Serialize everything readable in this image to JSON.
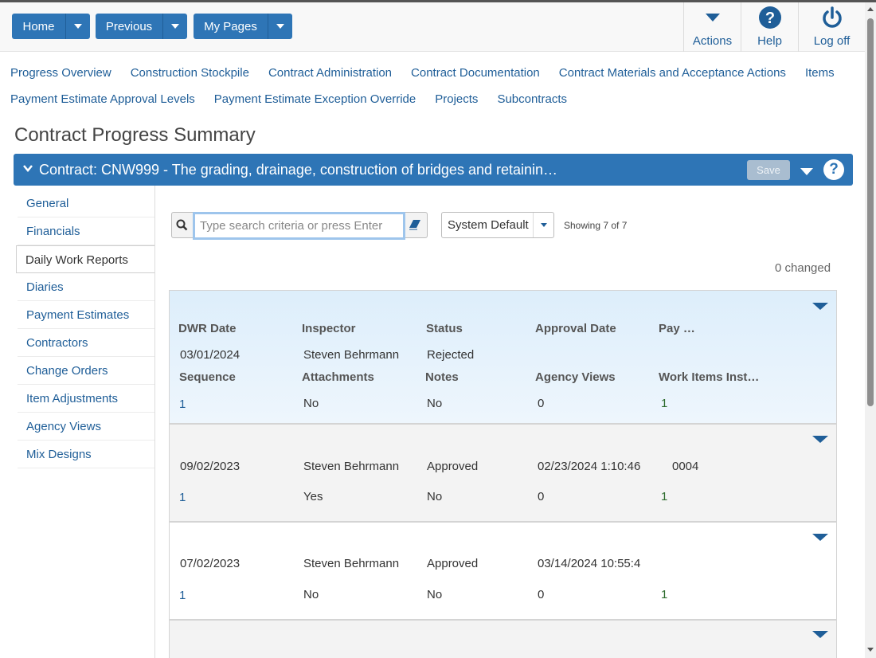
{
  "toolbar": {
    "home": "Home",
    "previous": "Previous",
    "my_pages": "My Pages",
    "actions": "Actions",
    "help": "Help",
    "logoff": "Log off"
  },
  "nav": {
    "row1": [
      "Progress Overview",
      "Construction Stockpile",
      "Contract Administration",
      "Contract Documentation",
      "Contract Materials and Acceptance Actions",
      "Items"
    ],
    "row2": [
      "Payment Estimate Approval Levels",
      "Payment Estimate Exception Override",
      "Projects",
      "Subcontracts"
    ]
  },
  "page_title": "Contract Progress Summary",
  "contract_bar": {
    "title": "Contract: CNW999 - The grading, drainage, construction of bridges and retainin…",
    "save": "Save",
    "help": "?"
  },
  "sidebar": [
    "General",
    "Financials",
    "Daily Work Reports",
    "Diaries",
    "Payment Estimates",
    "Contractors",
    "Change Orders",
    "Item Adjustments",
    "Agency Views",
    "Mix Designs"
  ],
  "search": {
    "placeholder": "Type search criteria or press Enter",
    "view": "System Default",
    "showing": "Showing 7 of 7",
    "changed": "0 changed"
  },
  "headers": {
    "dwr_date": "DWR Date",
    "inspector": "Inspector",
    "status": "Status",
    "approval_date": "Approval Date",
    "pay": "Pay …",
    "sequence": "Sequence",
    "attachments": "Attachments",
    "notes": "Notes",
    "agency_views": "Agency Views",
    "work_items": "Work Items Inst…"
  },
  "records": [
    {
      "date": "03/01/2024",
      "inspector": "Steven Behrmann",
      "status": "Rejected",
      "approval": "",
      "pay": "",
      "sequence": "1",
      "attachments": "No",
      "notes": "No",
      "agency_views": "0",
      "work_items": "1"
    },
    {
      "date": "09/02/2023",
      "inspector": "Steven Behrmann",
      "status": "Approved",
      "approval": "02/23/2024 1:10:46",
      "pay": "0004",
      "sequence": "1",
      "attachments": "Yes",
      "notes": "No",
      "agency_views": "0",
      "work_items": "1"
    },
    {
      "date": "07/02/2023",
      "inspector": "Steven Behrmann",
      "status": "Approved",
      "approval": "03/14/2024 10:55:4",
      "pay": "",
      "sequence": "1",
      "attachments": "No",
      "notes": "No",
      "agency_views": "0",
      "work_items": "1"
    }
  ]
}
